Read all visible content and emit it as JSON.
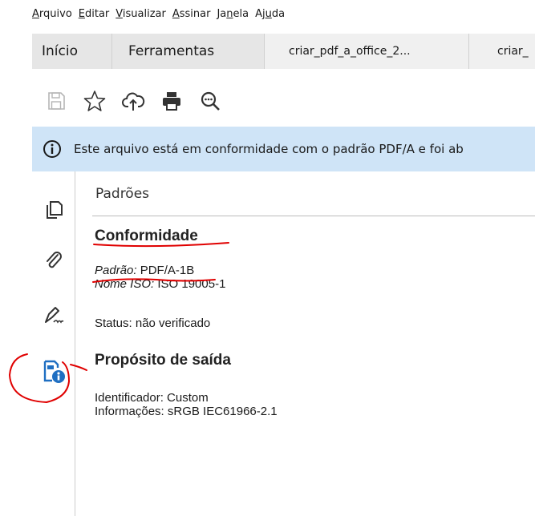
{
  "menu": {
    "items": [
      {
        "underline": "A",
        "rest": "rquivo"
      },
      {
        "underline": "E",
        "rest": "ditar"
      },
      {
        "underline": "V",
        "rest": "isualizar"
      },
      {
        "underline": "A",
        "rest": "ssinar"
      },
      {
        "pre": "Ja",
        "underline": "n",
        "rest": "ela"
      },
      {
        "pre": "Aj",
        "underline": "u",
        "rest": "da"
      }
    ]
  },
  "tabs": {
    "home": "Início",
    "tools": "Ferramentas",
    "doc1": "criar_pdf_a_office_2...",
    "doc2": "criar_"
  },
  "toolbar": {
    "icons": [
      "save-icon",
      "star-icon",
      "upload-cloud-icon",
      "print-icon",
      "zoom-icon"
    ]
  },
  "infobar": {
    "icon": "info-icon",
    "text": "Este arquivo está em conformidade com o padrão PDF/A e foi ab"
  },
  "rail": {
    "icons": [
      "pages-icon",
      "attachment-icon",
      "signature-icon",
      "standards-icon"
    ]
  },
  "panel": {
    "title": "Padrões",
    "conformance": {
      "heading": "Conformidade",
      "standard_label": "Padrão:",
      "standard_value": " PDF/A-1B",
      "iso_label": "Nome ISO:",
      "iso_value": " ISO 19005-1",
      "status": "Status: não verificado"
    },
    "output_intent": {
      "heading": "Propósito de saída",
      "identifier": "Identificador: Custom",
      "info": "Informações: sRGB IEC61966-2.1"
    }
  },
  "colors": {
    "infobar_bg": "#cfe4f7",
    "tab_bg": "#e6e6e6",
    "icon_blue": "#1f6fc2",
    "annotation_red": "#e00000"
  }
}
